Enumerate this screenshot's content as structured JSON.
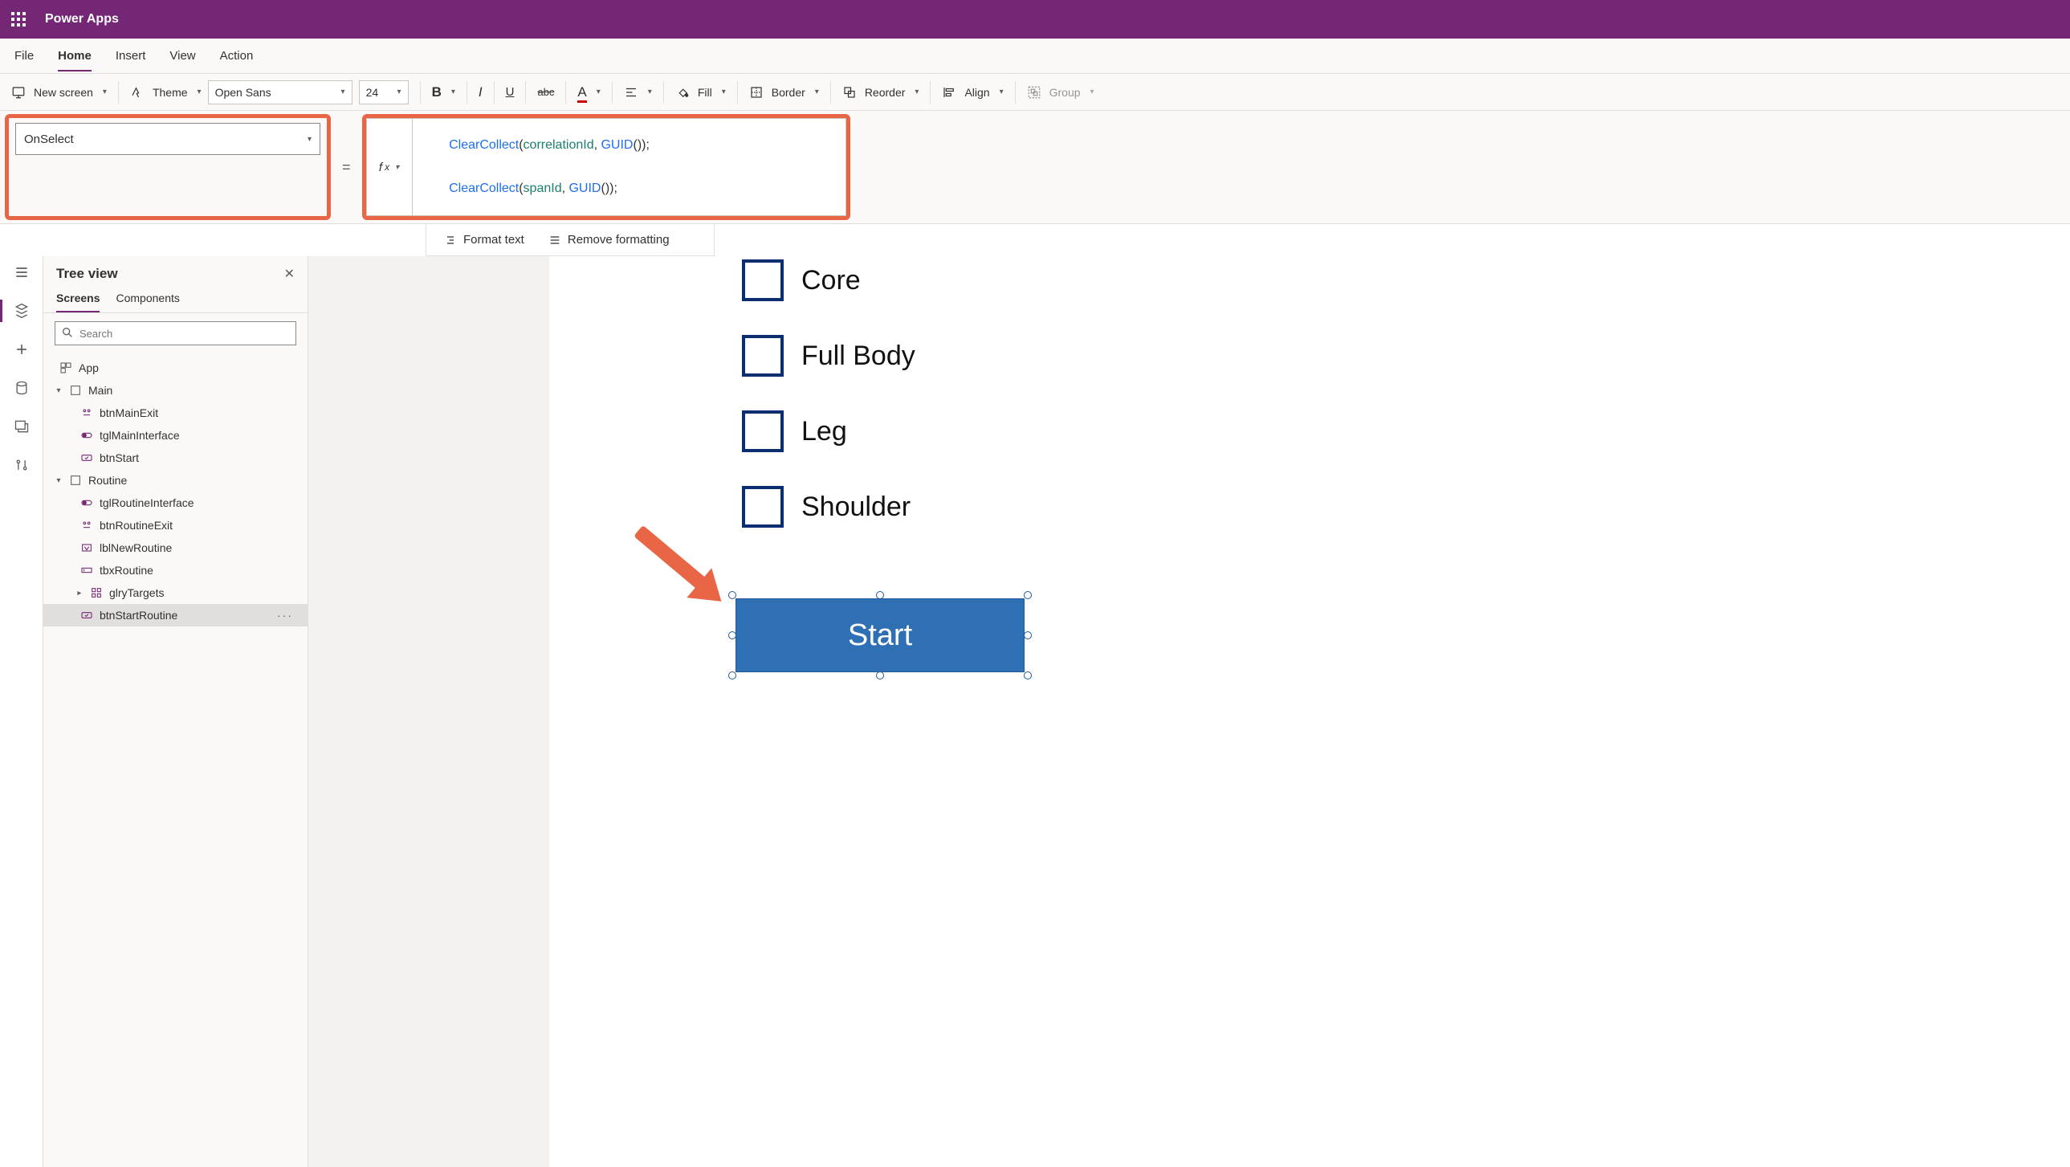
{
  "titlebar": {
    "app_name": "Power Apps"
  },
  "menubar": {
    "items": [
      "File",
      "Home",
      "Insert",
      "View",
      "Action"
    ],
    "active": "Home"
  },
  "ribbon": {
    "new_screen": "New screen",
    "theme": "Theme",
    "font": "Open Sans",
    "font_size": "24",
    "fill": "Fill",
    "border": "Border",
    "reorder": "Reorder",
    "align": "Align",
    "group": "Group"
  },
  "formula": {
    "property": "OnSelect",
    "line1": {
      "fn1": "ClearCollect",
      "p1": "(",
      "v1": "correlationId",
      "c": ", ",
      "fn2": "GUID",
      "p2": "());"
    },
    "line2": {
      "fn1": "ClearCollect",
      "p1": "(",
      "v1": "spanId",
      "c": ", ",
      "fn2": "GUID",
      "p2": "());"
    }
  },
  "fmtbar": {
    "format": "Format text",
    "remove": "Remove formatting"
  },
  "tree": {
    "title": "Tree view",
    "tabs": {
      "screens": "Screens",
      "components": "Components"
    },
    "search_placeholder": "Search",
    "app": "App",
    "screens": [
      {
        "name": "Main",
        "controls": [
          {
            "name": "btnMainExit",
            "kind": "component"
          },
          {
            "name": "tglMainInterface",
            "kind": "toggle"
          },
          {
            "name": "btnStart",
            "kind": "button"
          }
        ]
      },
      {
        "name": "Routine",
        "controls": [
          {
            "name": "tglRoutineInterface",
            "kind": "toggle"
          },
          {
            "name": "btnRoutineExit",
            "kind": "component"
          },
          {
            "name": "lblNewRoutine",
            "kind": "label"
          },
          {
            "name": "tbxRoutine",
            "kind": "textbox"
          },
          {
            "name": "glryTargets",
            "kind": "gallery",
            "collapsed": true
          },
          {
            "name": "btnStartRoutine",
            "kind": "button",
            "selected": true
          }
        ]
      }
    ]
  },
  "canvas": {
    "options": [
      "Core",
      "Full Body",
      "Leg",
      "Shoulder"
    ],
    "start_label": "Start"
  },
  "colors": {
    "brand": "#742774",
    "highlight": "#e86645",
    "primary_btn": "#2f6fb3",
    "chk_border": "#0b2e6f"
  }
}
